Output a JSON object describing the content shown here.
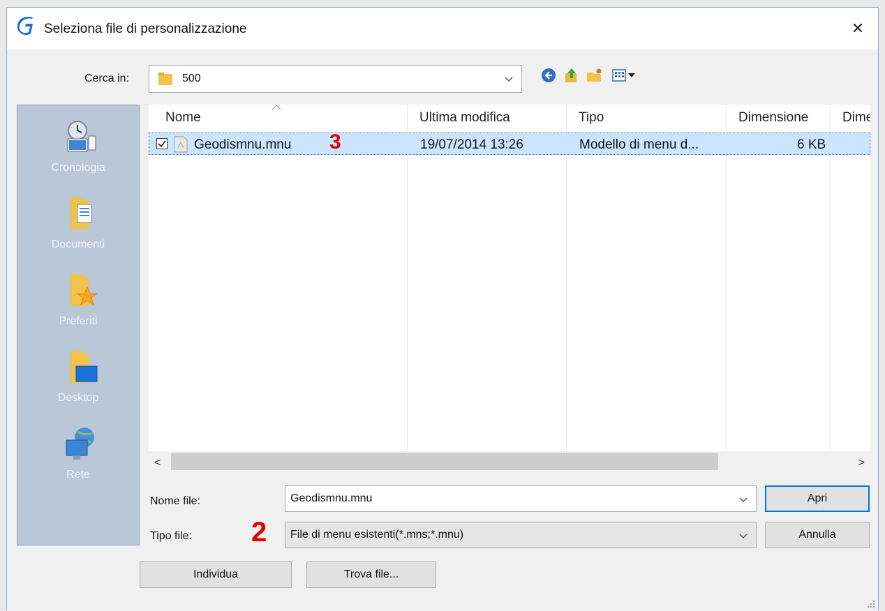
{
  "window": {
    "title": "Seleziona file di personalizzazione",
    "close_glyph": "✕"
  },
  "lookin": {
    "label": "Cerca in:",
    "value": "500"
  },
  "toolbar": {
    "icons": [
      "back-icon",
      "up-folder-icon",
      "new-folder-icon",
      "view-menu-icon"
    ]
  },
  "places": [
    {
      "label": "Cronologia",
      "icon": "history-icon"
    },
    {
      "label": "Documenti",
      "icon": "documents-icon"
    },
    {
      "label": "Preferiti",
      "icon": "favorites-icon"
    },
    {
      "label": "Desktop",
      "icon": "desktop-icon"
    },
    {
      "label": "Rete",
      "icon": "network-icon"
    }
  ],
  "filelist": {
    "columns": [
      "Nome",
      "Ultima modifica",
      "Tipo",
      "Dimensione",
      "Dime"
    ],
    "rows": [
      {
        "name": "Geodismnu.mnu",
        "modified": "19/07/2014 13:26",
        "type": "Modello di menu d...",
        "size": "6 KB",
        "checked": true
      }
    ]
  },
  "scroll": {
    "left": "<",
    "right": ">"
  },
  "form": {
    "filename_label": "Nome file:",
    "filename_value": "Geodismnu.mnu",
    "filetype_label": "Tipo file:",
    "filetype_value": "File di menu esistenti(*.mns;*.mnu)"
  },
  "buttons": {
    "open": "Apri",
    "cancel": "Annulla",
    "locate": "Individua",
    "find": "Trova file..."
  },
  "markers": {
    "type_marker": "2",
    "file_marker": "3"
  },
  "colors": {
    "accent": "#0078d7",
    "selection": "#cce5ff",
    "places_bg": "#b9c7d7",
    "marker_red": "#e00000"
  }
}
